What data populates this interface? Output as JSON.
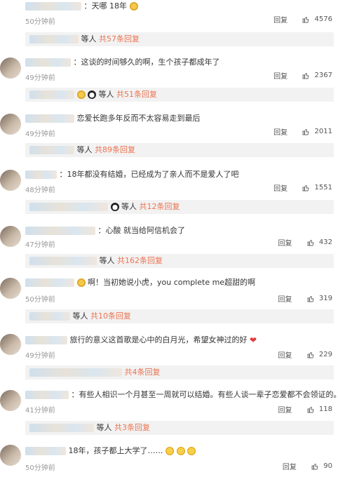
{
  "comments": [
    {
      "text": "：天哪 18年",
      "time": "50分钟前",
      "likes": "4576",
      "reply_label": "回复",
      "sub": "等人 共57条回复"
    },
    {
      "text": "：这谈的时间够久的啊，生个孩子都成年了",
      "time": "49分钟前",
      "likes": "2367",
      "reply_label": "回复",
      "sub": "等人 共51条回复"
    },
    {
      "text": "恋爱长跑多年反而不太容易走到最后",
      "time": "49分钟前",
      "likes": "2011",
      "reply_label": "回复",
      "sub": "等人 共89条回复"
    },
    {
      "text": "：18年都没有结婚，已经成为了亲人而不是爱人了吧",
      "time": "48分钟前",
      "likes": "1551",
      "reply_label": "回复",
      "sub": "等人 共12条回复"
    },
    {
      "text": "：心酸 就当给阿信机会了",
      "time": "47分钟前",
      "likes": "432",
      "reply_label": "回复",
      "sub": "等人 共162条回复"
    },
    {
      "text": "啊！当初她说小虎，you complete me超甜的啊",
      "time": "50分钟前",
      "likes": "319",
      "reply_label": "回复",
      "sub": "等人 共10条回复"
    },
    {
      "text": "旅行的意义这首歌是心中的白月光，希望女神过的好",
      "time": "49分钟前",
      "likes": "229",
      "reply_label": "回复",
      "sub": "共4条回复"
    },
    {
      "text": "：有些人相识一个月甚至一周就可以结婚。有些人谈一辈子恋爱都不会领证的。",
      "time": "41分钟前",
      "likes": "118",
      "reply_label": "回复",
      "sub": "等人 共3条回复"
    },
    {
      "text": "18年，孩子都上大学了……",
      "time": "50分钟前",
      "likes": "90",
      "reply_label": "回复"
    }
  ]
}
